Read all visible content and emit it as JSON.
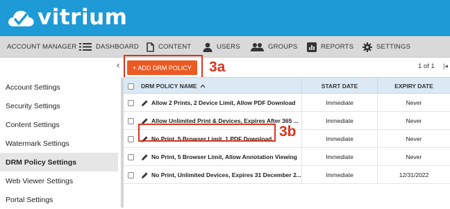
{
  "app": {
    "name": "vitrium"
  },
  "nav": {
    "items": [
      {
        "label": "ACCOUNT MANAGER",
        "icon": "none"
      },
      {
        "label": "DASHBOARD",
        "icon": "list-icon"
      },
      {
        "label": "CONTENT",
        "icon": "document-icon"
      },
      {
        "label": "USERS",
        "icon": "user-icon"
      },
      {
        "label": "GROUPS",
        "icon": "group-icon"
      },
      {
        "label": "REPORTS",
        "icon": "bar-chart-icon"
      },
      {
        "label": "SETTINGS",
        "icon": "gear-icon"
      }
    ]
  },
  "sidebar": {
    "items": [
      {
        "label": "Account Settings",
        "active": false
      },
      {
        "label": "Security Settings",
        "active": false
      },
      {
        "label": "Content Settings",
        "active": false
      },
      {
        "label": "Watermark Settings",
        "active": false
      },
      {
        "label": "DRM Policy Settings",
        "active": true
      },
      {
        "label": "Web Viewer Settings",
        "active": false
      },
      {
        "label": "Portal Settings",
        "active": false
      }
    ]
  },
  "toolbar": {
    "add_label": "+ ADD DRM POLICY"
  },
  "pager": {
    "text": "1 of 1"
  },
  "annotations": {
    "a": "3a",
    "b": "3b"
  },
  "colors": {
    "brand": "#1e9ad6",
    "accent": "#ec5a24",
    "callout": "#d9341f"
  },
  "table": {
    "columns": {
      "name": "DRM POLICY NAME",
      "start": "START DATE",
      "expiry": "EXPIRY DATE"
    },
    "sort": "ascending",
    "rows": [
      {
        "name": "Allow 2 Prints, 2 Device Limit, Allow PDF Download",
        "start": "Immediate",
        "expiry": "Never"
      },
      {
        "name": "Allow Unlimited Print & Devices, Expires After 365 ...",
        "start": "Immediate",
        "expiry": "Never"
      },
      {
        "name": "No Print, 5 Browser Limit, 1 PDF Download",
        "start": "Immediate",
        "expiry": "Never"
      },
      {
        "name": "No Print, 5 Browser Limit, Allow Annotation Viewing",
        "start": "Immediate",
        "expiry": "Never"
      },
      {
        "name": "No Print, Unlimited Devices, Expires 31 December 2...",
        "start": "Immediate",
        "expiry": "12/31/2022"
      }
    ]
  }
}
